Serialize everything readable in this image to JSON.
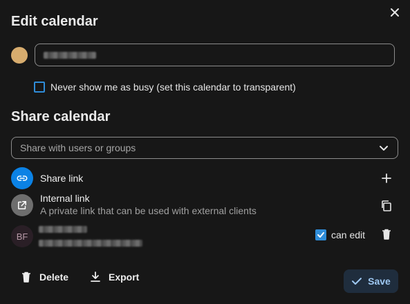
{
  "dialog": {
    "title": "Edit calendar",
    "calendar_color": "#d7ac6e",
    "transparent_label": "Never show me as busy (set this calendar to transparent)"
  },
  "share": {
    "title": "Share calendar",
    "search_placeholder": "Share with users or groups",
    "share_link_label": "Share link",
    "internal_link_title": "Internal link",
    "internal_link_description": "A private link that can be used with external clients",
    "user_initials": "BF",
    "can_edit_label": "can edit"
  },
  "footer": {
    "delete_label": "Delete",
    "export_label": "Export",
    "save_label": "Save"
  },
  "colors": {
    "accent": "#0b82e5",
    "background": "#171717"
  }
}
